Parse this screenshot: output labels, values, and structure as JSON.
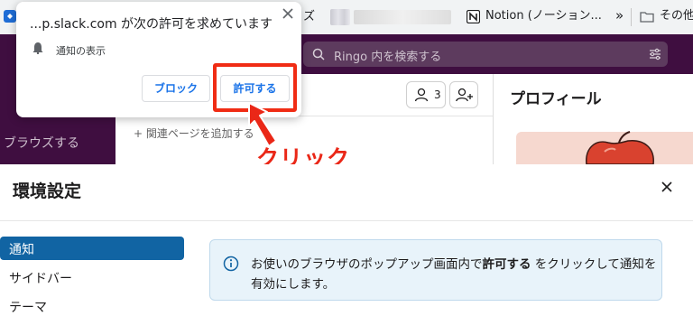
{
  "browser": {
    "bookmarks": {
      "truncated_label": "ズ",
      "notion_label": "Notion (ノーション...",
      "overflow": "»",
      "other_label": "その他の"
    }
  },
  "slack": {
    "search_placeholder": "Ringo 内を検索する",
    "sidebar_browse": "ブラウズする",
    "member_count": "3",
    "add_bookmark": "+ 関連ページを追加する",
    "profile_title": "プロフィール"
  },
  "popup": {
    "title": "...p.slack.com が次の許可を求めています",
    "permission": "通知の表示",
    "block_label": "ブロック",
    "allow_label": "許可する"
  },
  "annotation": {
    "click_label": "クリック",
    "highlight_color": "#f02c14"
  },
  "prefs": {
    "title": "環境設定",
    "nav_items": [
      "通知",
      "サイドバー",
      "テーマ"
    ],
    "info_part1": "お使いのブラウザのポップアップ画面内で",
    "info_bold": "許可する",
    "info_part2": "をクリックして通知を有効にします。"
  }
}
